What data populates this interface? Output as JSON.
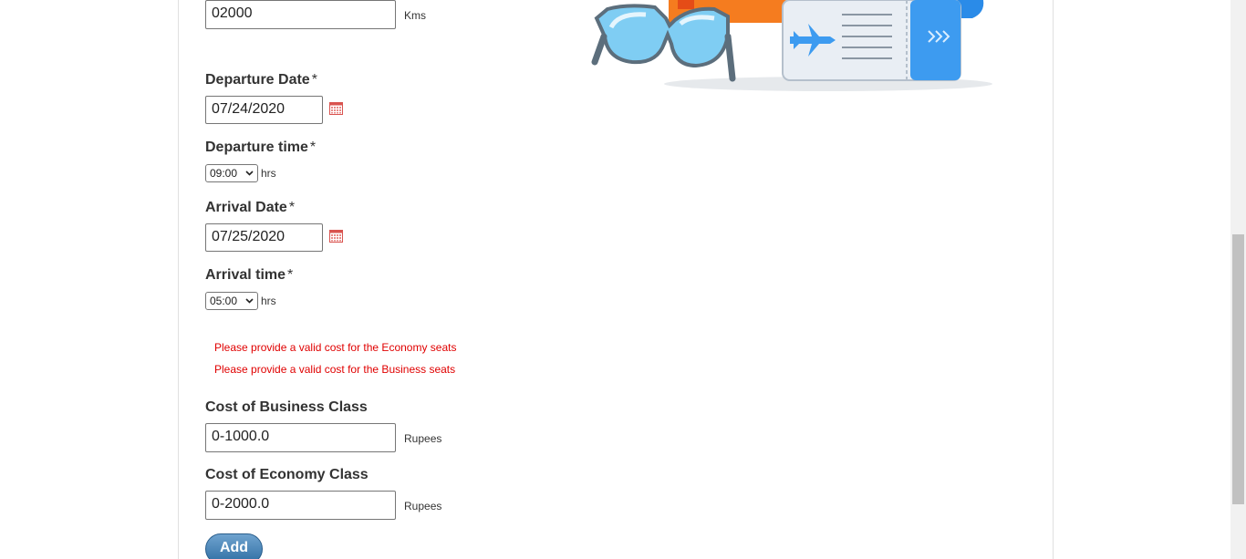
{
  "distance": {
    "value": "02000",
    "unit": "Kms"
  },
  "departure_date": {
    "label": "Departure Date",
    "required_mark": "*",
    "value": "07/24/2020"
  },
  "departure_time": {
    "label": "Departure time",
    "required_mark": "*",
    "value": "09:00",
    "unit": "hrs"
  },
  "arrival_date": {
    "label": "Arrival Date",
    "required_mark": "*",
    "value": "07/25/2020"
  },
  "arrival_time": {
    "label": "Arrival time",
    "required_mark": "*",
    "value": "05:00",
    "unit": "hrs"
  },
  "errors": [
    "Please provide a valid cost for the Economy seats",
    "Please provide a valid cost for the Business seats"
  ],
  "business_cost": {
    "label": "Cost of Business Class",
    "value": "0-1000.0",
    "unit": "Rupees"
  },
  "economy_cost": {
    "label": "Cost of Economy Class",
    "value": "0-2000.0",
    "unit": "Rupees"
  },
  "add_button": {
    "label": "Add"
  },
  "icons": {
    "calendar": "calendar-icon",
    "chevron": "chevron-down-icon",
    "illustration": "travel-sunglasses-ticket-illustration"
  },
  "colors": {
    "error": "#e00000",
    "button": "#2e6ea3",
    "calendar": "#d9534f"
  }
}
